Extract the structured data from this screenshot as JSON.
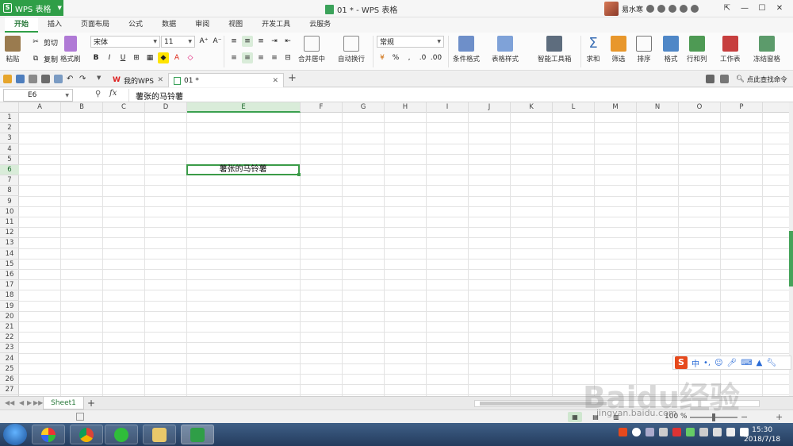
{
  "titlebar": {
    "app_name": "WPS 表格",
    "doc_title": "01 * - WPS 表格",
    "user_name": "易水寒"
  },
  "menu_tabs": [
    "开始",
    "插入",
    "页面布局",
    "公式",
    "数据",
    "审阅",
    "视图",
    "开发工具",
    "云服务"
  ],
  "ribbon": {
    "paste": "粘贴",
    "cut": "剪切",
    "copy": "复制",
    "format_painter": "格式刷",
    "font_name": "宋体",
    "font_size": "11",
    "merge_center": "合并居中",
    "wrap_text": "自动换行",
    "number_format": "常规",
    "percent": "%",
    "cond_format": "条件格式",
    "table_style": "表格样式",
    "smart_toolbox": "智能工具箱",
    "sum": "求和",
    "filter": "筛选",
    "sort": "排序",
    "format": "格式",
    "row_col": "行和列",
    "worksheet": "工作表",
    "freeze": "冻结窗格"
  },
  "doc_tabs": {
    "home_tab": "我的WPS",
    "file_tab": "01 *",
    "find_command": "点此查找命令"
  },
  "formula_bar": {
    "name_box": "E6",
    "fx": "fx",
    "content": "薯张的马铃薯"
  },
  "grid": {
    "columns": [
      "A",
      "B",
      "C",
      "D",
      "E",
      "F",
      "G",
      "H",
      "I",
      "J",
      "K",
      "L",
      "M",
      "N",
      "O",
      "P"
    ],
    "rows": [
      "1",
      "2",
      "3",
      "4",
      "5",
      "6",
      "7",
      "8",
      "9",
      "10",
      "11",
      "12",
      "13",
      "14",
      "15",
      "16",
      "17",
      "18",
      "19",
      "20",
      "21",
      "22",
      "23",
      "24",
      "25",
      "26",
      "27"
    ],
    "selected_column": "E",
    "selected_row": "6",
    "cell_E6": "薯张的马铃薯"
  },
  "sheet_bar": {
    "sheet_name": "Sheet1",
    "add": "+"
  },
  "status_bar": {
    "zoom": "100 %"
  },
  "ime": {
    "logo": "S",
    "mode": "中"
  },
  "watermark": {
    "text": "Baidu经验",
    "sub": "jingyan.baidu.com"
  },
  "taskbar": {
    "time": "15:30",
    "date": "2018/7/18"
  },
  "colors": {
    "accent": "#2f9e47",
    "selection": "#3b9b48"
  }
}
